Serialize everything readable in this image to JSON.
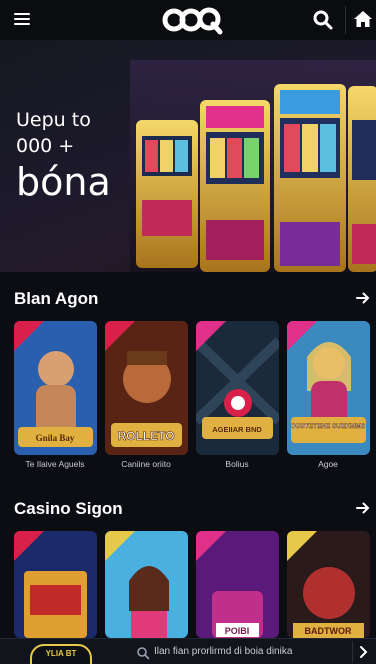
{
  "header": {
    "logo_text": "60Q",
    "menu_icon": "hamburger-icon",
    "search_icon": "search-icon",
    "home_icon": "home-icon"
  },
  "hero": {
    "line1": "Uepu to",
    "line2": "000 +",
    "line3": "bóna"
  },
  "section1": {
    "title": "Blan Agon",
    "arrow_icon": "arrow-right-icon",
    "cards": [
      {
        "label": "Te Ilaive Aguels",
        "art_text": "Gnila Bay"
      },
      {
        "label": "Caniine oriito",
        "art_text": "ROLLETO"
      },
      {
        "label": "Bolius",
        "art_text": "AGEIIAR BND"
      },
      {
        "label": "Agoe",
        "art_text": "OUSTETENE SUEKMMS"
      }
    ]
  },
  "section2": {
    "title": "Casino Sigon",
    "arrow_icon": "arrow-right-icon",
    "cards": [
      {
        "art_text": ""
      },
      {
        "art_text": ""
      },
      {
        "art_text": "POIBI"
      },
      {
        "art_text": "BADTWOR"
      }
    ]
  },
  "bottom_bar": {
    "badge_text": "YLIA BT",
    "text": "Ilan fian prorlirmd di boia dinika",
    "arrow_icon": "chevron-right-icon"
  },
  "colors": {
    "background": "#0b0d12",
    "accent_gold": "#e6c84a",
    "ribbon_red": "#d8204a",
    "ribbon_pink": "#e0308a",
    "ribbon_yellow": "#e6c84a"
  }
}
